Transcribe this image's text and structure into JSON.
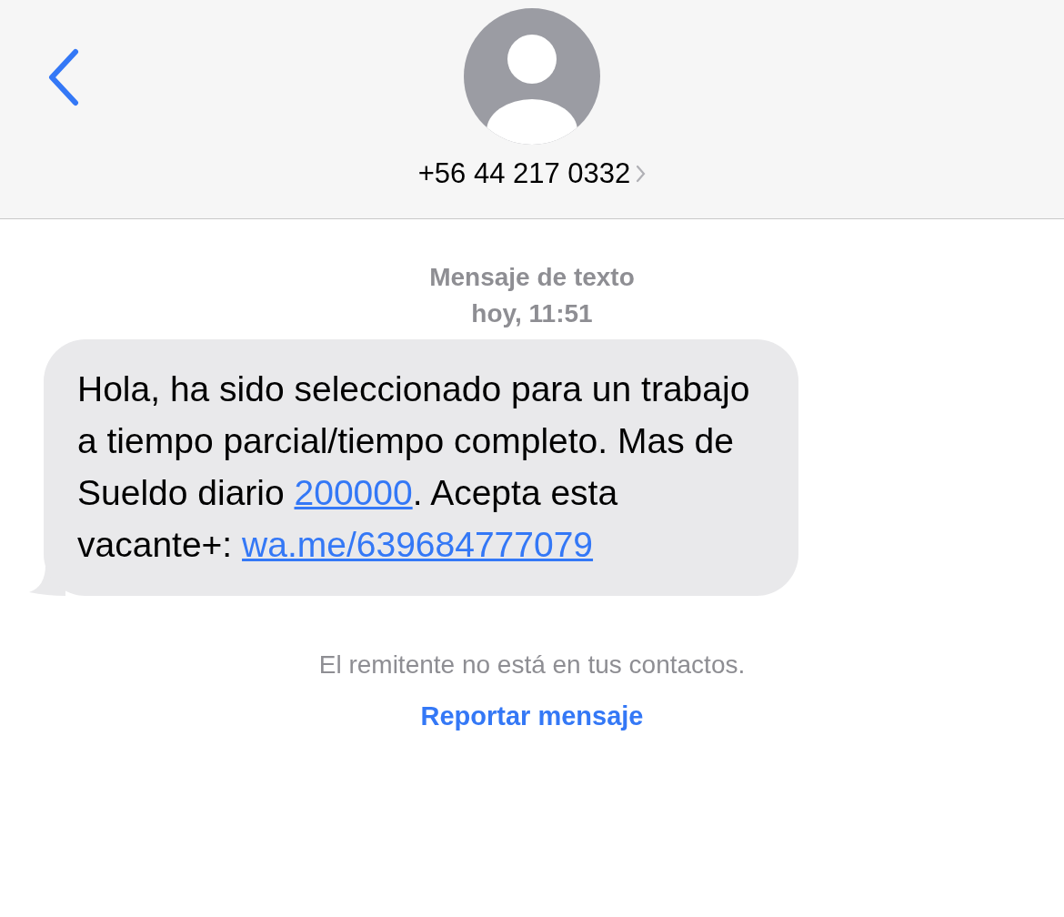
{
  "header": {
    "contact": "+56 44 217 0332"
  },
  "conversation": {
    "service": "Mensaje de texto",
    "time": "hoy, 11:51"
  },
  "message": {
    "segments": [
      {
        "kind": "text",
        "text": "Hola, ha sido seleccionado para un trabajo a tiempo parcial/tiempo completo. Mas de Sueldo diario "
      },
      {
        "kind": "link",
        "text": "200000"
      },
      {
        "kind": "text",
        "text": ". Acepta esta vacante+: "
      },
      {
        "kind": "link",
        "text": "wa.me/639684777079"
      }
    ]
  },
  "notice": "El remitente no está en tus contactos.",
  "report_link": "Reportar mensaje"
}
